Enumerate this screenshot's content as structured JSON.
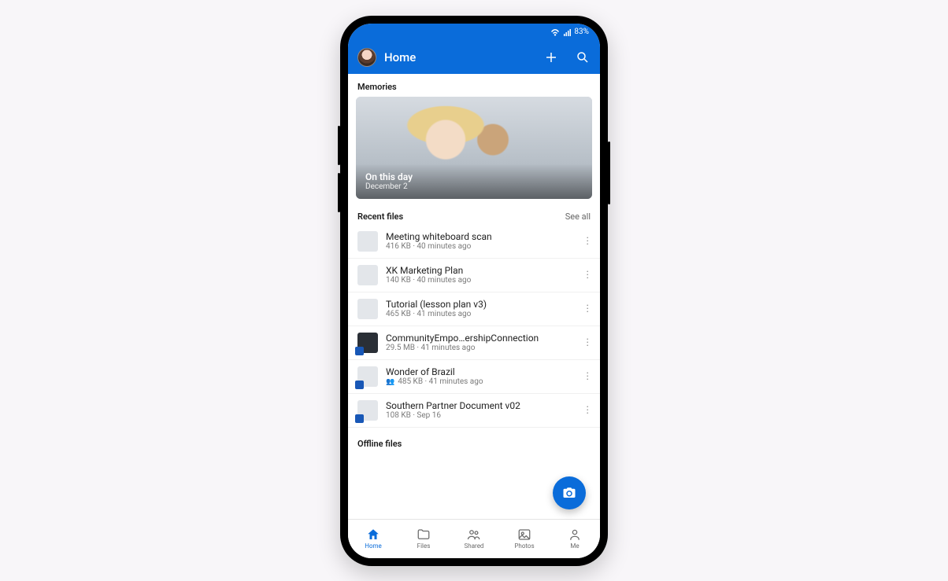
{
  "status": {
    "battery": "83%"
  },
  "appbar": {
    "title": "Home"
  },
  "memories": {
    "section_label": "Memories",
    "card_title": "On this day",
    "card_date": "December 2"
  },
  "recent": {
    "section_label": "Recent files",
    "see_all": "See all",
    "files": [
      {
        "name": "Meeting whiteboard scan",
        "size": "416 KB",
        "time": "40 minutes ago",
        "shared": false,
        "dark": false
      },
      {
        "name": "XK Marketing Plan",
        "size": "140 KB",
        "time": "40 minutes ago",
        "shared": false,
        "dark": false
      },
      {
        "name": "Tutorial (lesson plan v3)",
        "size": "465 KB",
        "time": "41 minutes ago",
        "shared": false,
        "dark": false
      },
      {
        "name": "CommunityEmpo…ershipConnection",
        "size": "29.5 MB",
        "time": "41 minutes ago",
        "shared": false,
        "dark": true
      },
      {
        "name": "Wonder of Brazil",
        "size": "485 KB",
        "time": "41 minutes ago",
        "shared": true,
        "dark": false
      },
      {
        "name": "Southern Partner Document v02",
        "size": "108 KB",
        "time": "Sep 16",
        "shared": false,
        "dark": false
      }
    ]
  },
  "offline": {
    "section_label": "Offline files"
  },
  "nav": {
    "items": [
      {
        "label": "Home"
      },
      {
        "label": "Files"
      },
      {
        "label": "Shared"
      },
      {
        "label": "Photos"
      },
      {
        "label": "Me"
      }
    ]
  }
}
